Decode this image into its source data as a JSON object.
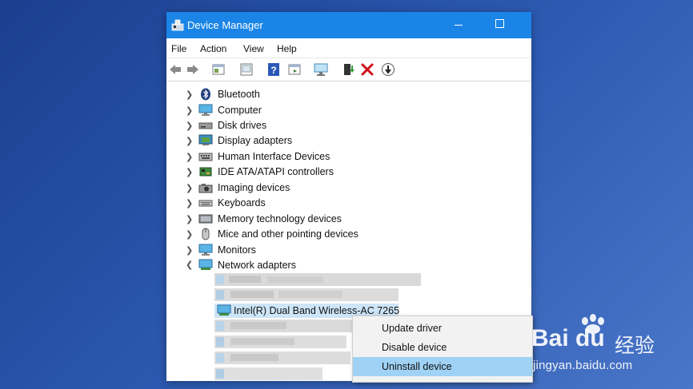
{
  "window": {
    "title": "Device Manager",
    "accent_color": "#1a85e6",
    "app_icon": "device-manager-icon"
  },
  "menu": [
    "File",
    "Action",
    "View",
    "Help"
  ],
  "toolbar_icons": [
    "back-arrow-icon",
    "forward-arrow-icon",
    "properties-icon",
    "show-hidden-icon",
    "help-icon",
    "action-panel-icon",
    "scan-hardware-icon",
    "update-driver-icon",
    "uninstall-icon",
    "disable-device-icon"
  ],
  "tree": {
    "items": [
      {
        "label": "Bluetooth",
        "icon": "bluetooth-icon",
        "expanded": false
      },
      {
        "label": "Computer",
        "icon": "computer-icon",
        "expanded": false
      },
      {
        "label": "Disk drives",
        "icon": "disk-drive-icon",
        "expanded": false
      },
      {
        "label": "Display adapters",
        "icon": "display-adapter-icon",
        "expanded": false
      },
      {
        "label": "Human Interface Devices",
        "icon": "hid-icon",
        "expanded": false
      },
      {
        "label": "IDE ATA/ATAPI controllers",
        "icon": "ide-controller-icon",
        "expanded": false
      },
      {
        "label": "Imaging devices",
        "icon": "camera-icon",
        "expanded": false
      },
      {
        "label": "Keyboards",
        "icon": "keyboard-icon",
        "expanded": false
      },
      {
        "label": "Memory technology devices",
        "icon": "memory-icon",
        "expanded": false
      },
      {
        "label": "Mice and other pointing devices",
        "icon": "mouse-icon",
        "expanded": false
      },
      {
        "label": "Monitors",
        "icon": "monitor-icon",
        "expanded": false
      },
      {
        "label": "Network adapters",
        "icon": "network-adapter-icon",
        "expanded": true
      }
    ],
    "selected_device": "Intel(R) Dual Band Wireless-AC 7265"
  },
  "context_menu": {
    "items": [
      "Update driver",
      "Disable device",
      "Uninstall device"
    ],
    "highlighted": "Uninstall device"
  },
  "watermark": {
    "brand": "Bai du",
    "cn": "经验",
    "url": "jingyan.baidu.com"
  }
}
